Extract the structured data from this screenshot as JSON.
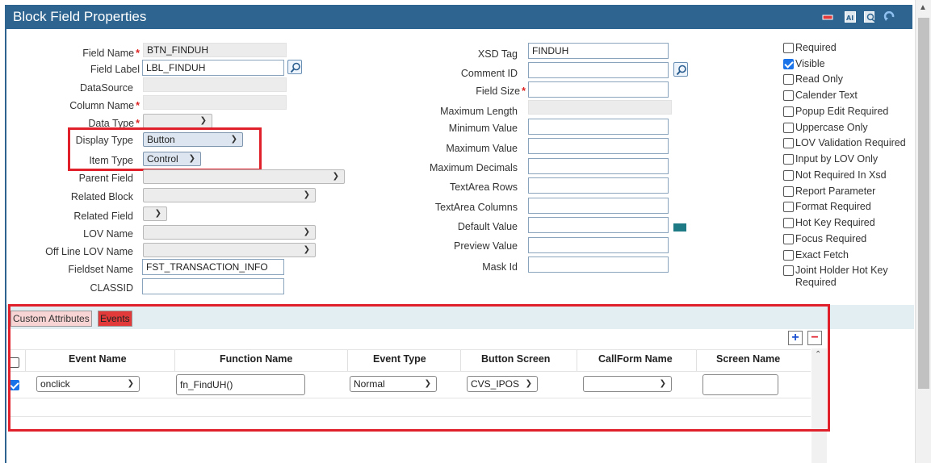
{
  "header": {
    "title": "Block Field Properties"
  },
  "header_icons": [
    "minimize-icon",
    "ai-icon",
    "preview-icon",
    "refresh-icon"
  ],
  "left_form": {
    "field_name": {
      "label": "Field Name",
      "value": "BTN_FINDUH",
      "required": true
    },
    "field_label": {
      "label": "Field Label",
      "value": "LBL_FINDUH"
    },
    "datasource": {
      "label": "DataSource",
      "value": ""
    },
    "column_name": {
      "label": "Column Name",
      "value": "",
      "required": true
    },
    "data_type": {
      "label": "Data Type",
      "value": "",
      "required": true
    },
    "display_type": {
      "label": "Display Type",
      "value": "Button"
    },
    "item_type": {
      "label": "Item Type",
      "value": "Control"
    },
    "parent_field": {
      "label": "Parent Field",
      "value": ""
    },
    "related_block": {
      "label": "Related Block",
      "value": ""
    },
    "related_field": {
      "label": "Related Field",
      "value": ""
    },
    "lov_name": {
      "label": "LOV Name",
      "value": ""
    },
    "offline_lov_name": {
      "label": "Off Line LOV Name",
      "value": ""
    },
    "fieldset_name": {
      "label": "Fieldset Name",
      "value": "FST_TRANSACTION_INFO"
    },
    "classid": {
      "label": "CLASSID",
      "value": ""
    }
  },
  "mid_form": {
    "xsd_tag": {
      "label": "XSD Tag",
      "value": "FINDUH"
    },
    "comment_id": {
      "label": "Comment ID",
      "value": ""
    },
    "field_size": {
      "label": "Field Size",
      "value": "",
      "required": true
    },
    "maximum_length": {
      "label": "Maximum Length",
      "value": ""
    },
    "minimum_value": {
      "label": "Minimum Value",
      "value": ""
    },
    "maximum_value": {
      "label": "Maximum Value",
      "value": ""
    },
    "maximum_decimals": {
      "label": "Maximum Decimals",
      "value": ""
    },
    "textarea_rows": {
      "label": "TextArea Rows",
      "value": ""
    },
    "textarea_columns": {
      "label": "TextArea Columns",
      "value": ""
    },
    "default_value": {
      "label": "Default Value",
      "value": ""
    },
    "preview_value": {
      "label": "Preview Value",
      "value": ""
    },
    "mask_id": {
      "label": "Mask Id",
      "value": ""
    }
  },
  "checkboxes": [
    {
      "label": "Required",
      "checked": false
    },
    {
      "label": "Visible",
      "checked": true
    },
    {
      "label": "Read Only",
      "checked": false
    },
    {
      "label": "Calender Text",
      "checked": false
    },
    {
      "label": "Popup Edit Required",
      "checked": false
    },
    {
      "label": "Uppercase Only",
      "checked": false
    },
    {
      "label": "LOV Validation Required",
      "checked": false
    },
    {
      "label": "Input by LOV Only",
      "checked": false
    },
    {
      "label": "Not Required In Xsd",
      "checked": false
    },
    {
      "label": "Report Parameter",
      "checked": false
    },
    {
      "label": "Format Required",
      "checked": false
    },
    {
      "label": "Hot Key Required",
      "checked": false
    },
    {
      "label": "Focus Required",
      "checked": false
    },
    {
      "label": "Exact Fetch",
      "checked": false
    },
    {
      "label": "Joint Holder Hot Key Required",
      "checked": false
    }
  ],
  "tabs": [
    {
      "label": "Custom Attributes"
    },
    {
      "label": "Events",
      "active": true
    }
  ],
  "events_table": {
    "columns": [
      "Event Name",
      "Function Name",
      "Event Type",
      "Button Screen",
      "CallForm Name",
      "Screen Name"
    ],
    "rows": [
      {
        "checked": true,
        "event_name": "onclick",
        "function_name": "fn_FindUH()",
        "event_type": "Normal",
        "button_screen": "CVS_IPOS",
        "callform_name": "",
        "screen_name": ""
      }
    ]
  },
  "colors": {
    "header": "#2e6590",
    "highlight": "#e0202b",
    "accent_swatch": "#1e7b86"
  }
}
